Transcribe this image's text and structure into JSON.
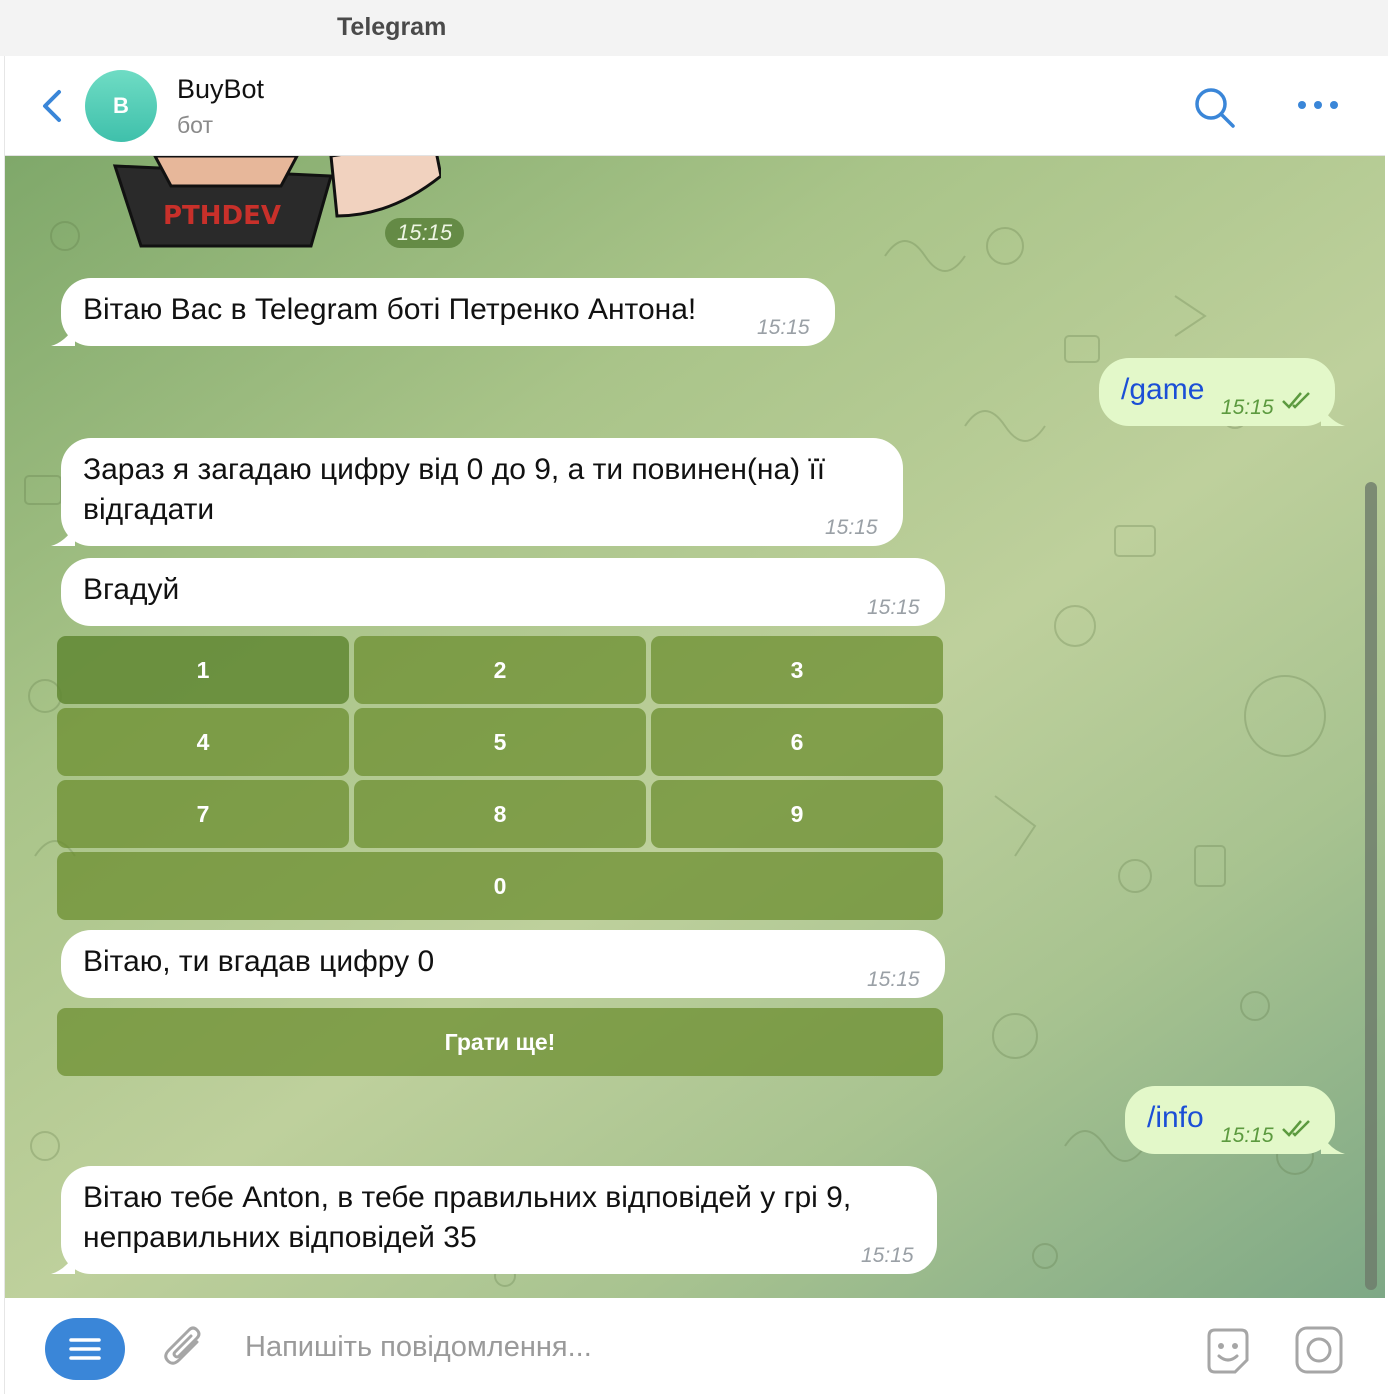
{
  "window": {
    "title": "Telegram"
  },
  "header": {
    "avatar_letter": "B",
    "name": "BuyBot",
    "status": "бот"
  },
  "messages": {
    "sticker_time": "15:15",
    "m1": {
      "text": "Вітаю Вас в Telegram боті Петренко Антона!",
      "time": "15:15"
    },
    "m2": {
      "text": "/game",
      "time": "15:15"
    },
    "m3": {
      "line1": "Зараз я загадаю цифру від 0 до 9, а ти повинен(на) її",
      "line2": "відгадати",
      "time": "15:15"
    },
    "m4": {
      "text": "Вгадуй",
      "time": "15:15"
    },
    "m5": {
      "text": "Вітаю, ти вгадав цифру 0",
      "time": "15:15"
    },
    "m6": {
      "text": "/info",
      "time": "15:15"
    },
    "m7": {
      "line1": "Вітаю тебе Anton, в тебе правильних відповідей у грі 9,",
      "line2": "неправильних відповідей 35",
      "time": "15:15"
    }
  },
  "keyboard": {
    "digits": [
      "1",
      "2",
      "3",
      "4",
      "5",
      "6",
      "7",
      "8",
      "9",
      "0"
    ],
    "play_again": "Грати ще!"
  },
  "composer": {
    "placeholder": "Напишіть повідомлення..."
  },
  "colors": {
    "accent": "#3a86d8",
    "outgoing_bubble": "#e3f8c9",
    "avatar": "#4ccdb5",
    "button": "#6f8f30"
  },
  "icons": [
    "back-chevron-icon",
    "search-icon",
    "more-icon",
    "menu-icon",
    "paperclip-icon",
    "sticker-icon",
    "voice-icon",
    "double-check-icon"
  ]
}
